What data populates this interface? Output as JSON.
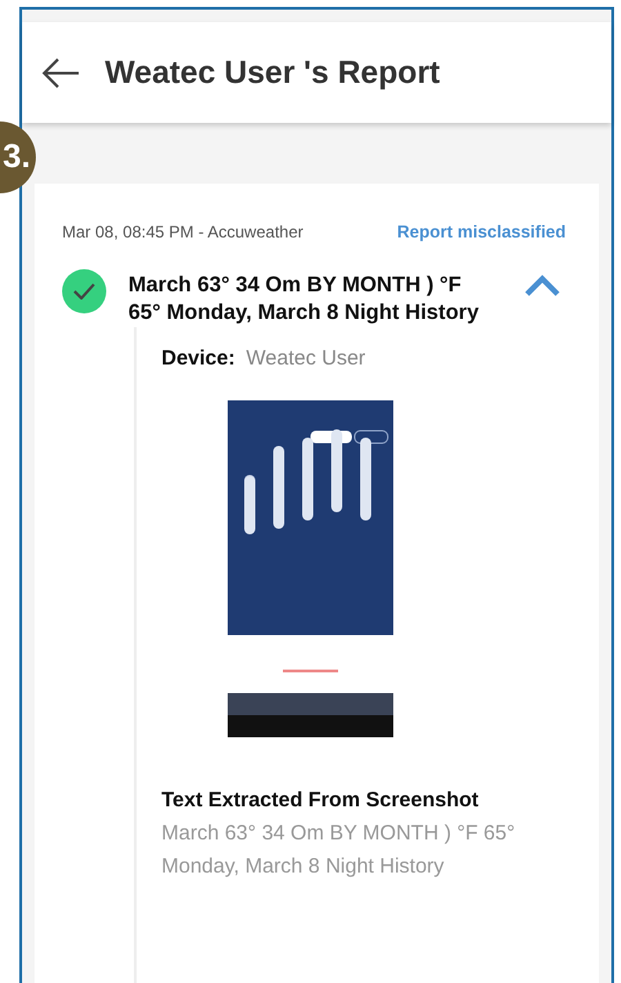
{
  "badge": {
    "label": "3."
  },
  "header": {
    "title": "Weatec User 's Report"
  },
  "report": {
    "meta": "Mar 08, 08:45 PM - Accuweather",
    "action": "Report misclassified",
    "verified": true,
    "expanded": true,
    "title": "March 63° 34 Om BY MONTH ) °F 65° Monday, March 8 Night History",
    "device_label": "Device:",
    "device_value": "Weatec User",
    "extracted_heading": "Text Extracted From Screenshot",
    "extracted_text": "March 63° 34 Om BY MONTH ) °F 65° Monday, March 8 Night History"
  }
}
